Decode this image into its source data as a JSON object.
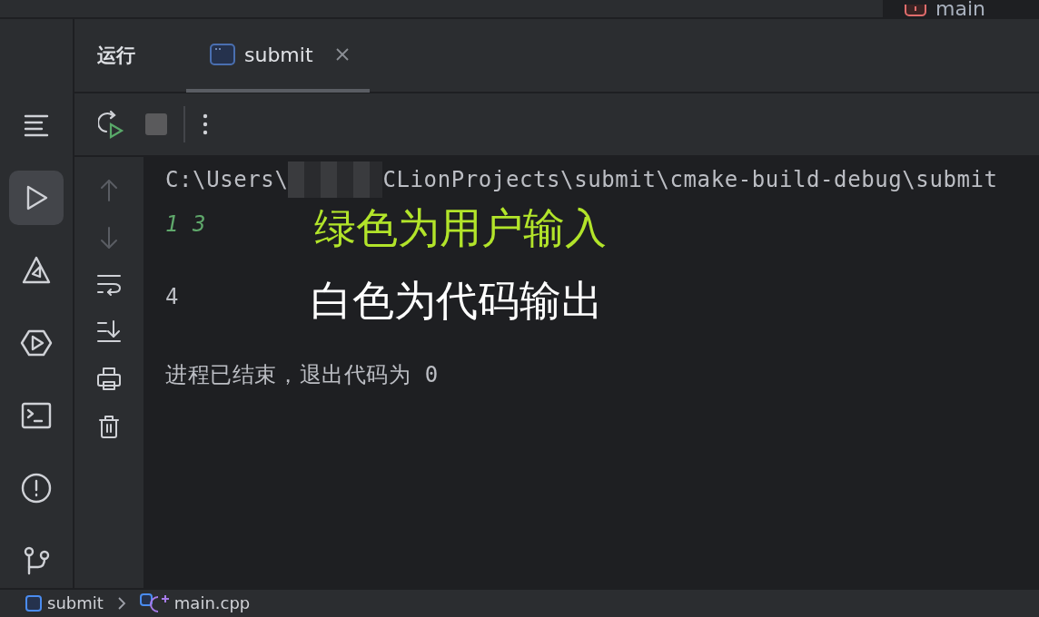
{
  "top_bar": {
    "branch": "main"
  },
  "sidebar": {
    "items": [
      {
        "kind": "menu",
        "selected": false
      },
      {
        "kind": "run",
        "selected": true
      },
      {
        "kind": "build",
        "selected": false
      },
      {
        "kind": "services",
        "selected": false
      },
      {
        "kind": "terminal",
        "selected": false
      },
      {
        "kind": "problems",
        "selected": false
      },
      {
        "kind": "git",
        "selected": false
      }
    ]
  },
  "run_panel": {
    "title": "运行",
    "tabs": [
      {
        "label": "submit",
        "selected": true
      }
    ],
    "toolbar": [
      {
        "kind": "rerun"
      },
      {
        "kind": "stop",
        "disabled": true
      },
      {
        "kind": "more"
      }
    ],
    "gutter": [
      {
        "kind": "up",
        "disabled": true
      },
      {
        "kind": "down",
        "disabled": true
      },
      {
        "kind": "wrap",
        "disabled": false
      },
      {
        "kind": "scroll",
        "disabled": false
      },
      {
        "kind": "print",
        "disabled": false
      },
      {
        "kind": "trash",
        "disabled": false
      }
    ],
    "console": [
      {
        "kind": "path",
        "parts": [
          "C:\\Users\\",
          "CLionProjects\\submit\\cmake-build-debug\\submit"
        ]
      },
      {
        "kind": "input",
        "text": "1 3",
        "annotation": "绿色为用户输入"
      },
      {
        "kind": "output",
        "text": "4",
        "annotation": "白色为代码输出"
      },
      {
        "kind": "output",
        "text": "进程已结束，退出代码为 0"
      }
    ]
  },
  "breadcrumbs": [
    "submit",
    "main.cpp"
  ]
}
